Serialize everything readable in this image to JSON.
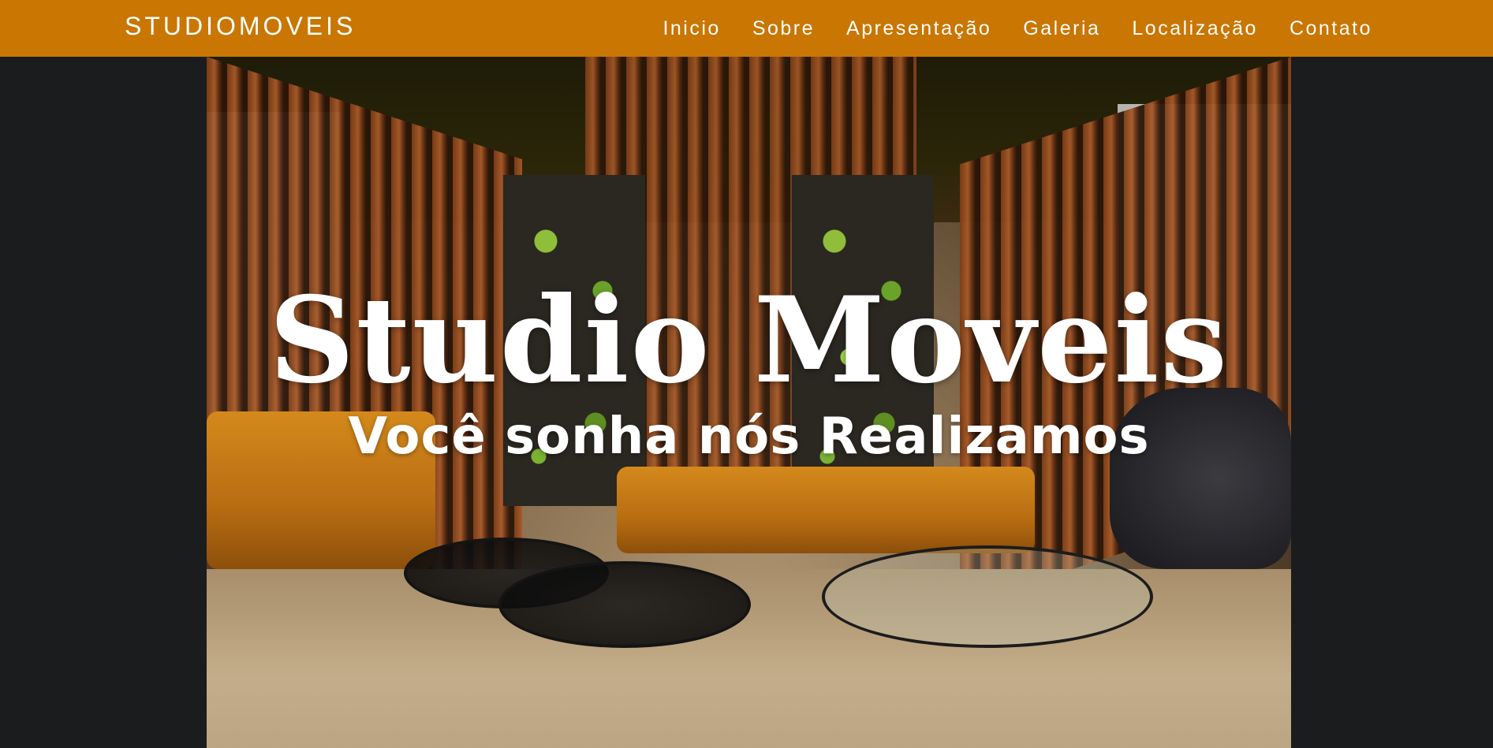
{
  "nav": {
    "brand": "STUDIOMOVEIS",
    "links": [
      {
        "label": "Inicio"
      },
      {
        "label": "Sobre"
      },
      {
        "label": "Apresentação"
      },
      {
        "label": "Galeria"
      },
      {
        "label": "Localização"
      },
      {
        "label": "Contato"
      }
    ]
  },
  "hero": {
    "title": "Studio Moveis",
    "subtitle": "Você sonha nós Realizamos"
  },
  "colors": {
    "navbar": "#c97602",
    "page_background": "#1b1c1e",
    "text": "#ffffff"
  }
}
